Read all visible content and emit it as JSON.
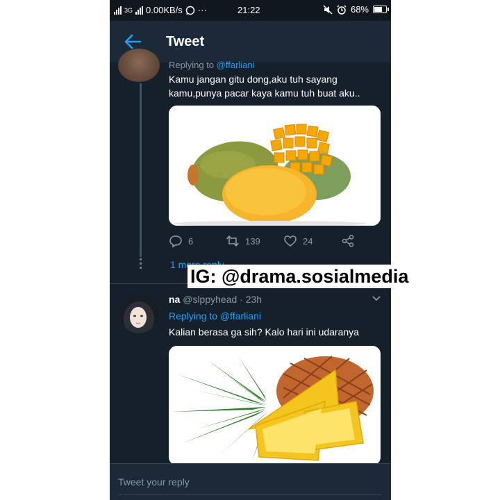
{
  "status_bar": {
    "network": "ᵌᵍ ᴴ ℯ",
    "speed": "0.00KB/s",
    "more": "···",
    "time": "21:22",
    "battery": "68%"
  },
  "header": {
    "title": "Tweet"
  },
  "tweet1": {
    "replying_prefix": "Replying to",
    "replying_handle": "@ffarliani",
    "text": "Kamu jangan gitu dong,aku tuh sayang kamu,punya pacar kaya kamu tuh buat aku..",
    "image": "mango",
    "actions": {
      "replies": "6",
      "retweets": "139",
      "likes": "24"
    },
    "more_replies": "1 more reply"
  },
  "tweet2": {
    "name": "na",
    "handle": "@slppyhead",
    "time": "· 23h",
    "replying_prefix": "Replying to",
    "replying_handle": "@ffarliani",
    "text": "Kalian berasa ga sih? Kalo hari ini udaranya",
    "image": "pineapple"
  },
  "reply_bar": {
    "placeholder": "Tweet your reply"
  },
  "watermark": "IG: @drama.sosialmedia",
  "colors": {
    "background": "#15202b",
    "accent": "#1da1f2",
    "muted": "#8899a6"
  }
}
